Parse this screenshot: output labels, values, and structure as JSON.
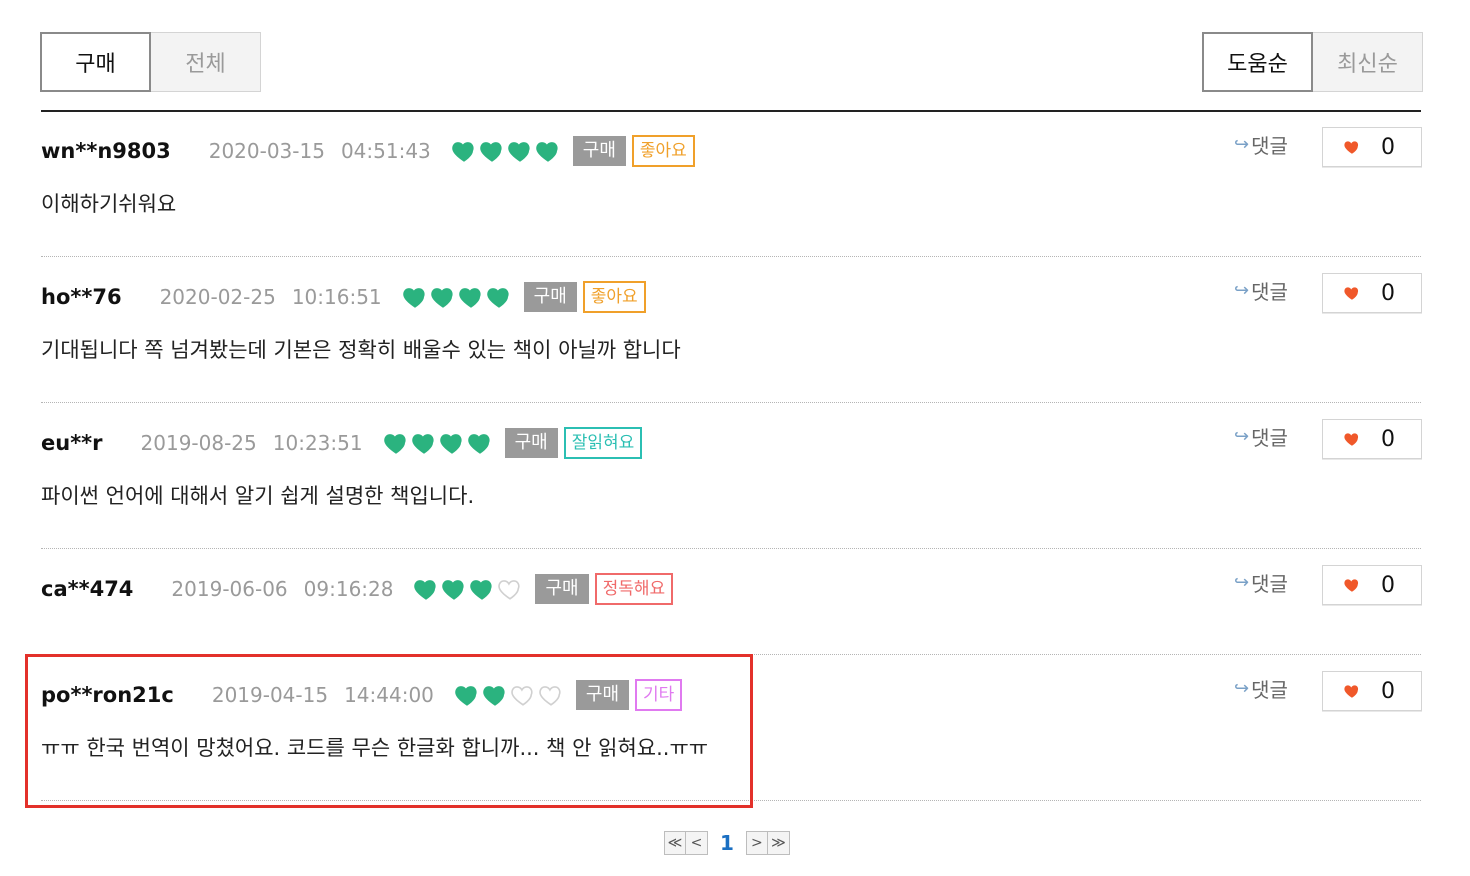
{
  "filter_tabs": [
    {
      "label": "구매",
      "active": true
    },
    {
      "label": "전체",
      "active": false
    }
  ],
  "sort_tabs": [
    {
      "label": "도움순",
      "active": true
    },
    {
      "label": "최신순",
      "active": false
    }
  ],
  "reviews": [
    {
      "user": "wn**n9803",
      "date": "2020-03-15",
      "time": "04:51:43",
      "rating": 4,
      "buy_badge": "구매",
      "tag": "좋아요",
      "tag_color": "#f0a02a",
      "text": "이해하기쉬워요",
      "reply_label": "댓글",
      "likes": "0"
    },
    {
      "user": "ho**76",
      "date": "2020-02-25",
      "time": "10:16:51",
      "rating": 4,
      "buy_badge": "구매",
      "tag": "좋아요",
      "tag_color": "#f0a02a",
      "text": "기대됩니다 쪽 넘겨봤는데 기본은 정확히 배울수 있는 책이 아닐까 합니다",
      "reply_label": "댓글",
      "likes": "0"
    },
    {
      "user": "eu**r",
      "date": "2019-08-25",
      "time": "10:23:51",
      "rating": 4,
      "buy_badge": "구매",
      "tag": "잘읽혀요",
      "tag_color": "#2bbfb3",
      "text": "파이썬 언어에 대해서 알기 쉽게 설명한 책입니다.",
      "reply_label": "댓글",
      "likes": "0"
    },
    {
      "user": "ca**474",
      "date": "2019-06-06",
      "time": "09:16:28",
      "rating": 3,
      "buy_badge": "구매",
      "tag": "정독해요",
      "tag_color": "#f06a6a",
      "text": "",
      "reply_label": "댓글",
      "likes": "0"
    },
    {
      "user": "po**ron21c",
      "date": "2019-04-15",
      "time": "14:44:00",
      "rating": 2,
      "buy_badge": "구매",
      "tag": "기타",
      "tag_color": "#e07af0",
      "text": "ㅠㅠ 한국 번역이 망쳤어요. 코드를 무슨 한글화 합니까... 책 안 읽혀요..ㅠㅠ",
      "reply_label": "댓글",
      "likes": "0"
    }
  ],
  "max_rating": 4,
  "colors": {
    "heart_filled": "#2bb37f",
    "heart_empty": "#d0d0d0",
    "like_heart": "#f0582a",
    "highlight": "#e3312a"
  },
  "pagination": {
    "first": "≪",
    "prev": "<",
    "current": "1",
    "next": ">",
    "last": "≫"
  }
}
